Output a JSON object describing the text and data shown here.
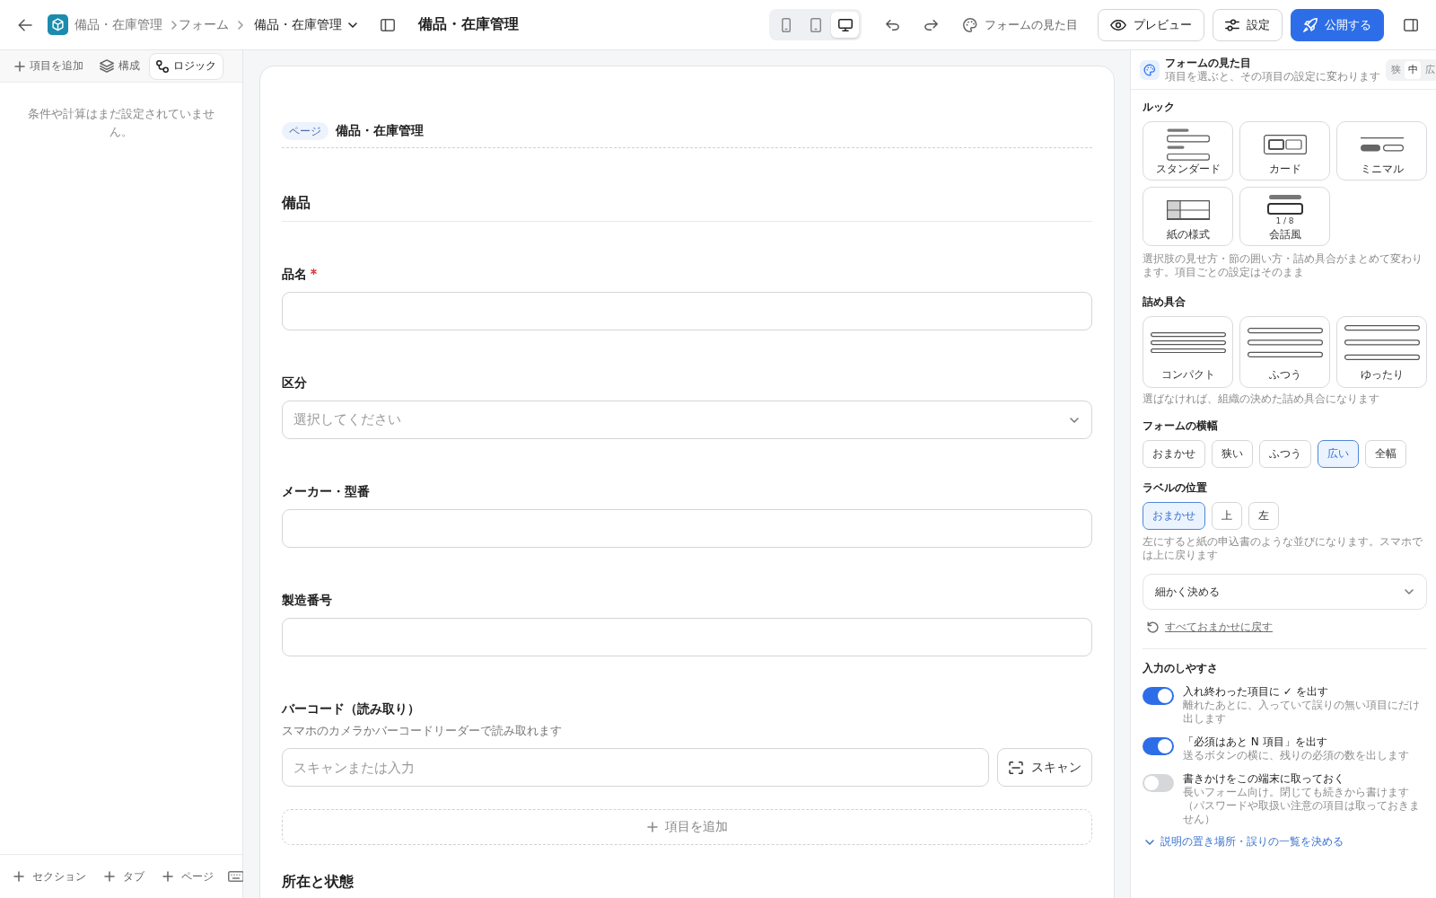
{
  "top_bar": {
    "breadcrumb": [
      {
        "label": "備品・在庫管理",
        "kind": "link"
      },
      {
        "label": "フォーム",
        "kind": "link"
      },
      {
        "label": "備品・在庫管理",
        "kind": "dropdown"
      }
    ],
    "title": "備品・在庫管理",
    "device_modes": [
      {
        "kind": "phone",
        "selected": false
      },
      {
        "kind": "tablet",
        "selected": false
      },
      {
        "kind": "desktop",
        "selected": true
      }
    ],
    "appearance_button": "フォームの見た目",
    "buttons": [
      {
        "label": "プレビュー",
        "kind": "preview"
      },
      {
        "label": "設定",
        "kind": "settings"
      },
      {
        "label": "公開する",
        "kind": "publish"
      }
    ]
  },
  "left_panel": {
    "tabs": [
      {
        "label": "項目を追加",
        "kind": "add",
        "selected": false
      },
      {
        "label": "構成",
        "kind": "structure",
        "selected": false
      },
      {
        "label": "ロジック",
        "kind": "logic",
        "selected": true
      }
    ],
    "empty_message": "条件や計算はまだ設定されていません。",
    "footer_buttons": [
      {
        "label": "セクション"
      },
      {
        "label": "タブ"
      },
      {
        "label": "ページ"
      }
    ]
  },
  "form": {
    "page_badge": "ページ",
    "page_title": "備品・在庫管理",
    "sections": [
      {
        "title": "備品",
        "fields": [
          {
            "label": "品名",
            "kind": "text",
            "required": true
          },
          {
            "label": "区分",
            "kind": "select",
            "required": false,
            "placeholder": "選択してください"
          },
          {
            "label": "メーカー・型番",
            "kind": "text",
            "required": false
          },
          {
            "label": "製造番号",
            "kind": "text",
            "required": false
          },
          {
            "label": "バーコード（読み取り）",
            "kind": "scan",
            "required": false,
            "hint": "スマホのカメラかバーコードリーダーで読み取れます",
            "placeholder": "スキャンまたは入力",
            "button": "スキャン"
          }
        ],
        "add_item": "項目を追加"
      },
      {
        "title": "所在と状態"
      }
    ]
  },
  "right_panel": {
    "title": "フォームの見た目",
    "subtitle": "項目を選ぶと、その項目の設定に変わります",
    "size_options": [
      {
        "label": "狭",
        "selected": false
      },
      {
        "label": "中",
        "selected": true
      },
      {
        "label": "広",
        "selected": false
      }
    ],
    "look": {
      "label": "ルック",
      "options": [
        {
          "label": "スタンダード",
          "kind": "standard",
          "selected": false
        },
        {
          "label": "カード",
          "kind": "card",
          "selected": false
        },
        {
          "label": "ミニマル",
          "kind": "minimal",
          "selected": false
        },
        {
          "label": "紙の様式",
          "kind": "paper",
          "selected": false
        },
        {
          "label": "会話風",
          "kind": "conversation",
          "selected": false,
          "caption": "1 / 8"
        }
      ],
      "hint": "選択肢の見せ方・節の囲い方・詰め具合がまとめて変わります。項目ごとの設定はそのまま"
    },
    "density": {
      "label": "詰め具合",
      "options": [
        {
          "label": "コンパクト",
          "kind": "compact",
          "selected": false
        },
        {
          "label": "ふつう",
          "kind": "normal",
          "selected": false
        },
        {
          "label": "ゆったり",
          "kind": "relaxed",
          "selected": false
        }
      ],
      "hint": "選ばなければ、組織の決めた詰め具合になります"
    },
    "form_width": {
      "label": "フォームの横幅",
      "options": [
        {
          "label": "おまかせ",
          "selected": false
        },
        {
          "label": "狭い",
          "selected": false
        },
        {
          "label": "ふつう",
          "selected": false
        },
        {
          "label": "広い",
          "selected": true
        },
        {
          "label": "全幅",
          "selected": false
        }
      ]
    },
    "label_position": {
      "label": "ラベルの位置",
      "options": [
        {
          "label": "おまかせ",
          "selected": true
        },
        {
          "label": "上",
          "selected": false
        },
        {
          "label": "左",
          "selected": false
        }
      ],
      "hint": "左にすると紙の申込書のような並びになります。スマホでは上に戻ります"
    },
    "advanced": "細かく決める",
    "reset_link": "すべておまかせに戻す",
    "usability": {
      "label": "入力のしやすさ",
      "toggles": [
        {
          "label": "入れ終わった項目に ✓ を出す",
          "description": "離れたあとに、入っていて誤りの無い項目にだけ出します",
          "on": true
        },
        {
          "label": "「必須はあと N 項目」を出す",
          "description": "送るボタンの横に、残りの必須の数を出します",
          "on": true
        },
        {
          "label": "書きかけをこの端末に取っておく",
          "description": "長いフォーム向け。閉じても続きから書けます（パスワードや取扱い注意の項目は取っておきません）",
          "on": false
        }
      ]
    },
    "more_link": "説明の置き場所・誤りの一覧を決める"
  }
}
